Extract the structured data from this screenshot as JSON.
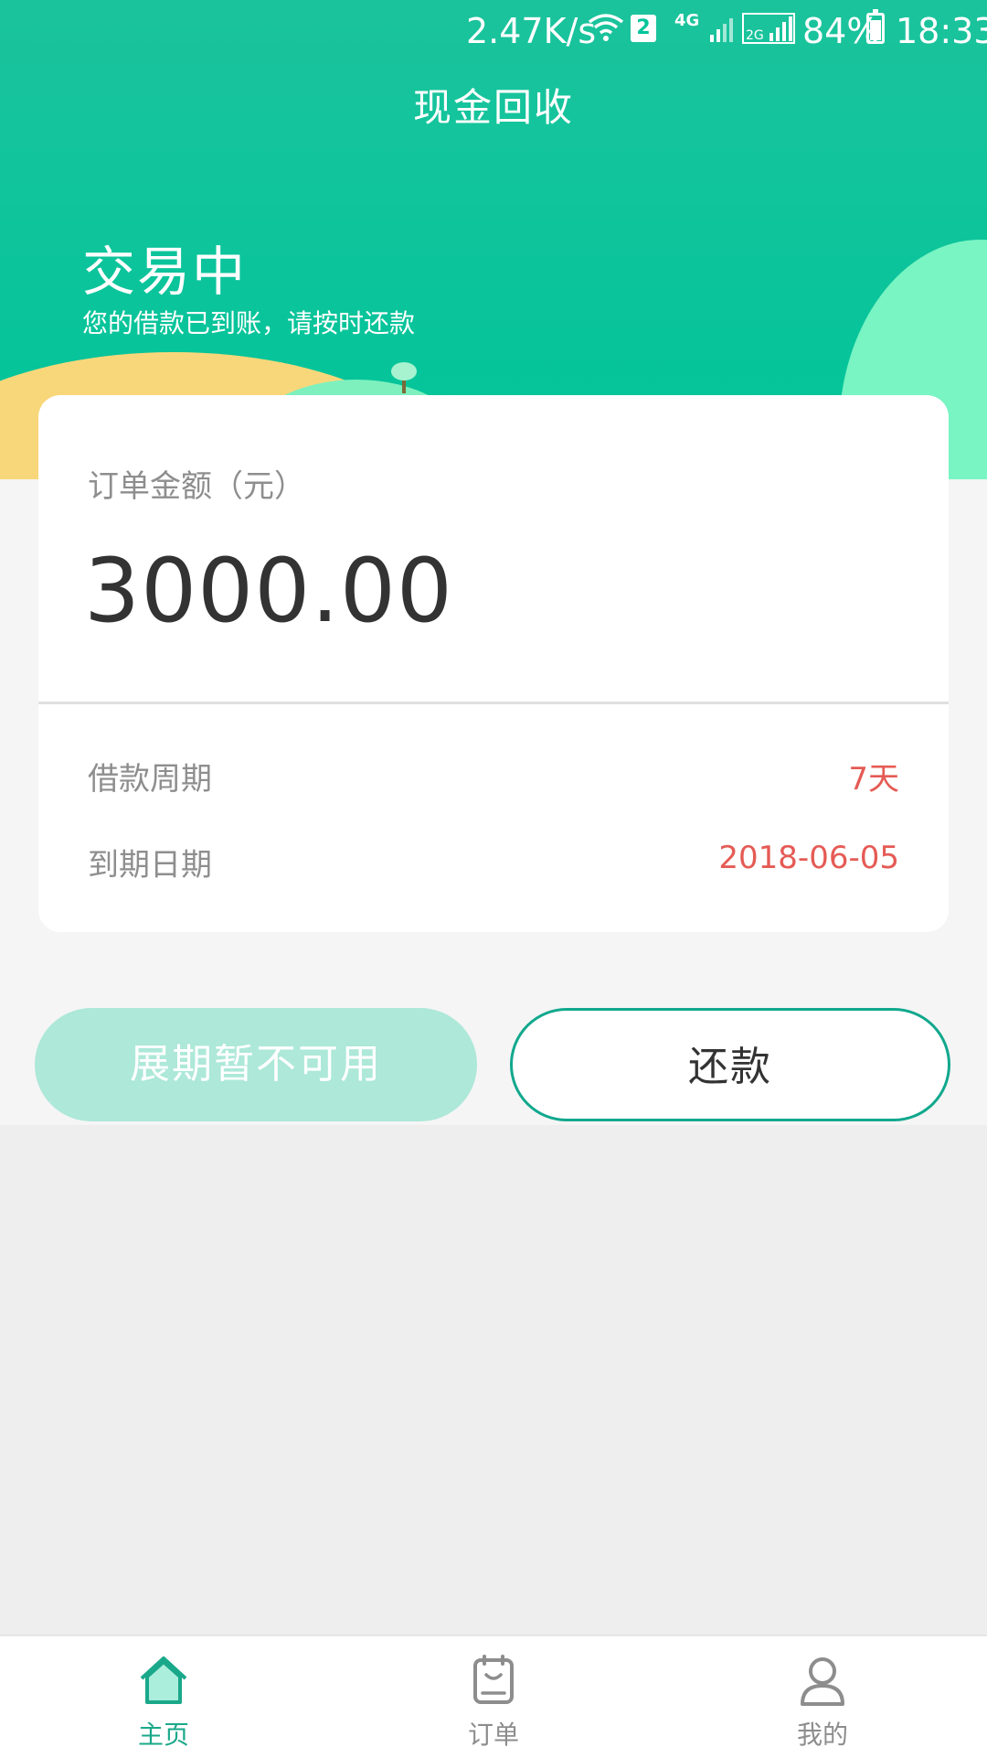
{
  "status_bar": {
    "speed": "2.47K/s",
    "sim_slot": "2",
    "network": "4G",
    "network2": "2G",
    "battery": "84%",
    "time": "18:33"
  },
  "header": {
    "title": "现金回收",
    "state_title": "交易中",
    "state_subtitle": "您的借款已到账，请按时还款"
  },
  "card": {
    "amount_label": "订单金额（元）",
    "amount_value": "3000.00",
    "period_label": "借款周期",
    "period_value": "7天",
    "due_label": "到期日期",
    "due_value": "2018-06-05"
  },
  "buttons": {
    "extend_label": "展期暂不可用",
    "repay_label": "还款"
  },
  "tabbar": {
    "items": [
      {
        "label": "主页",
        "icon": "home-icon",
        "active": true
      },
      {
        "label": "订单",
        "icon": "order-icon",
        "active": false
      },
      {
        "label": "我的",
        "icon": "user-icon",
        "active": false
      }
    ]
  },
  "colors": {
    "brand_green": "#00c59a",
    "accent_red": "#e55b55",
    "disabled_button": "#ade8d8",
    "repay_border": "#11a88d"
  }
}
